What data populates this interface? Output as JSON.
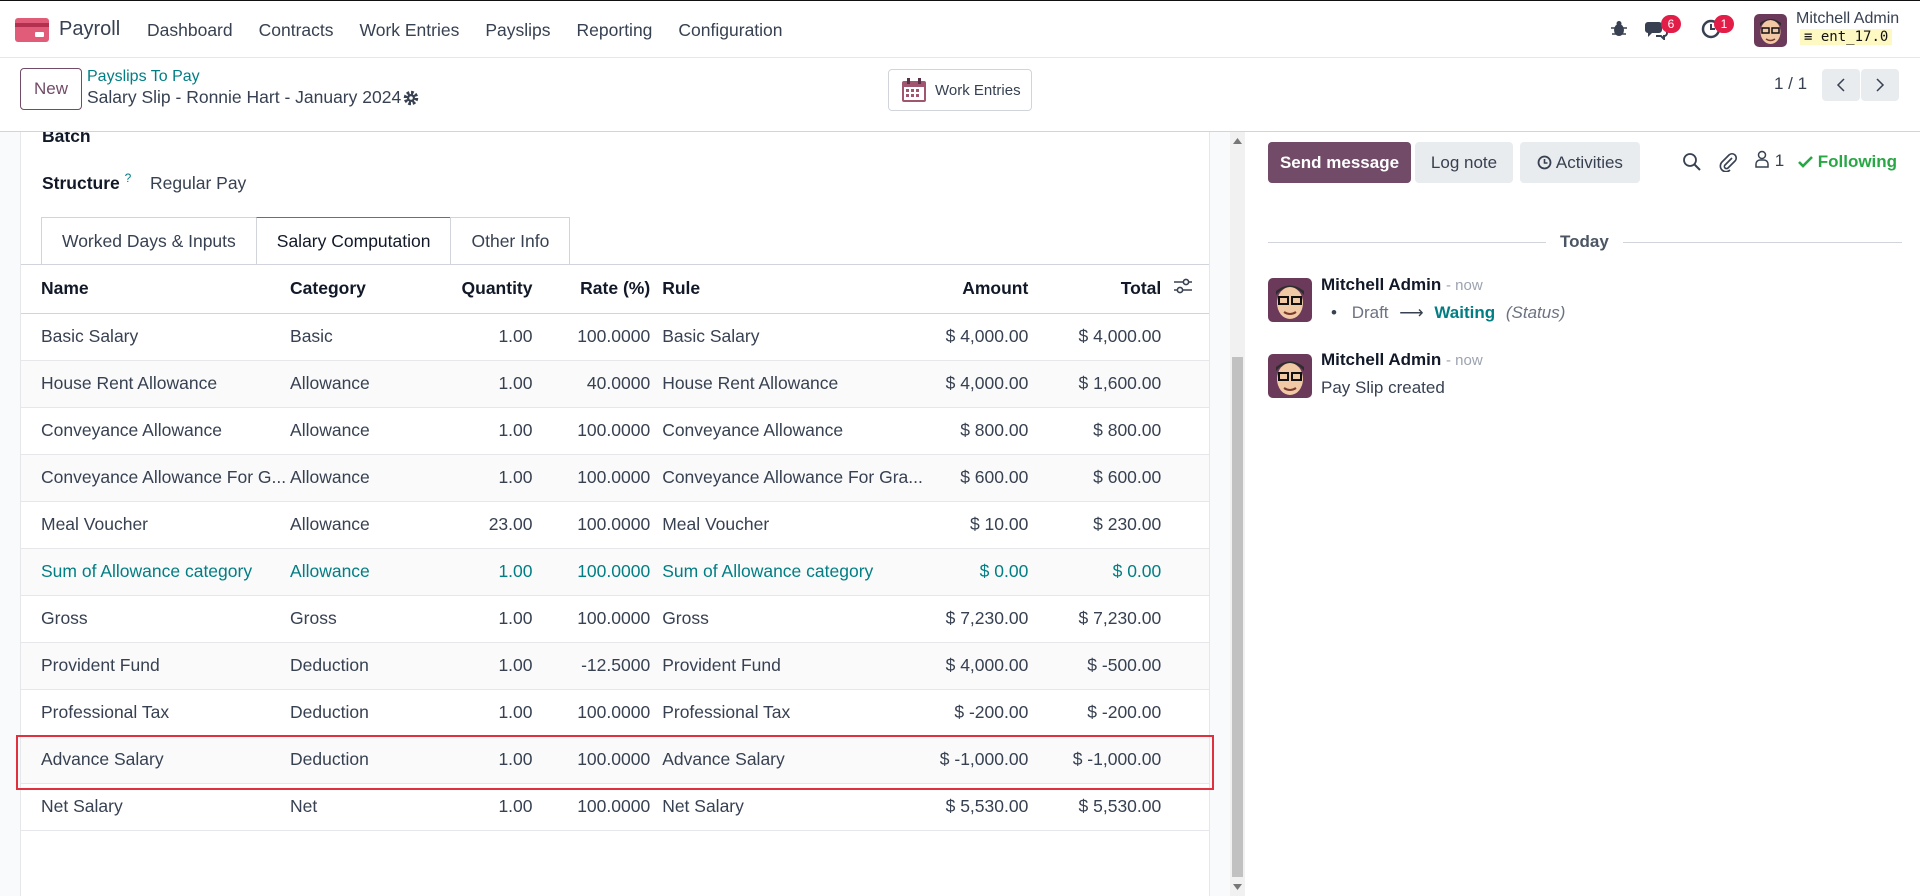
{
  "nav": {
    "app_name": "Payroll",
    "menu": [
      "Dashboard",
      "Contracts",
      "Work Entries",
      "Payslips",
      "Reporting",
      "Configuration"
    ],
    "messages_count": "6",
    "activities_count": "1",
    "user_name": "Mitchell Admin",
    "db_name": "ent_17.0"
  },
  "control": {
    "new_label": "New",
    "breadcrumb": "Payslips To Pay",
    "record_title": "Salary Slip - Ronnie Hart - January 2024",
    "work_entries_label": "Work Entries",
    "pager": "1 / 1"
  },
  "form": {
    "batch_label": "Batch",
    "structure_label": "Structure",
    "structure_help": "?",
    "structure_value": "Regular Pay",
    "tabs": [
      "Worked Days & Inputs",
      "Salary Computation",
      "Other Info"
    ],
    "columns": {
      "name": "Name",
      "category": "Category",
      "quantity": "Quantity",
      "rate": "Rate (%)",
      "rule": "Rule",
      "amount": "Amount",
      "total": "Total"
    },
    "rows": [
      {
        "name": "Basic Salary",
        "category": "Basic",
        "quantity": "1.00",
        "rate": "100.0000",
        "rule": "Basic Salary",
        "amount": "$ 4,000.00",
        "total": "$ 4,000.00"
      },
      {
        "name": "House Rent Allowance",
        "category": "Allowance",
        "quantity": "1.00",
        "rate": "40.0000",
        "rule": "House Rent Allowance",
        "amount": "$ 4,000.00",
        "total": "$ 1,600.00"
      },
      {
        "name": "Conveyance Allowance",
        "category": "Allowance",
        "quantity": "1.00",
        "rate": "100.0000",
        "rule": "Conveyance Allowance",
        "amount": "$ 800.00",
        "total": "$ 800.00"
      },
      {
        "name": "Conveyance Allowance For G...",
        "category": "Allowance",
        "quantity": "1.00",
        "rate": "100.0000",
        "rule": "Conveyance Allowance For Gra...",
        "amount": "$ 600.00",
        "total": "$ 600.00"
      },
      {
        "name": "Meal Voucher",
        "category": "Allowance",
        "quantity": "23.00",
        "rate": "100.0000",
        "rule": "Meal Voucher",
        "amount": "$ 10.00",
        "total": "$ 230.00"
      },
      {
        "name": "Sum of Allowance category",
        "category": "Allowance",
        "quantity": "1.00",
        "rate": "100.0000",
        "rule": "Sum of Allowance category",
        "amount": "$ 0.00",
        "total": "$ 0.00"
      },
      {
        "name": "Gross",
        "category": "Gross",
        "quantity": "1.00",
        "rate": "100.0000",
        "rule": "Gross",
        "amount": "$ 7,230.00",
        "total": "$ 7,230.00"
      },
      {
        "name": "Provident Fund",
        "category": "Deduction",
        "quantity": "1.00",
        "rate": "-12.5000",
        "rule": "Provident Fund",
        "amount": "$ 4,000.00",
        "total": "$ -500.00"
      },
      {
        "name": "Professional Tax",
        "category": "Deduction",
        "quantity": "1.00",
        "rate": "100.0000",
        "rule": "Professional Tax",
        "amount": "$ -200.00",
        "total": "$ -200.00"
      },
      {
        "name": "Advance Salary",
        "category": "Deduction",
        "quantity": "1.00",
        "rate": "100.0000",
        "rule": "Advance Salary",
        "amount": "$ -1,000.00",
        "total": "$ -1,000.00"
      },
      {
        "name": "Net Salary",
        "category": "Net",
        "quantity": "1.00",
        "rate": "100.0000",
        "rule": "Net Salary",
        "amount": "$ 5,530.00",
        "total": "$ 5,530.00"
      }
    ]
  },
  "chatter": {
    "send_message": "Send message",
    "log_note": "Log note",
    "activities": "Activities",
    "followers_count": "1",
    "following": "Following",
    "date_separator": "Today",
    "messages": [
      {
        "author": "Mitchell Admin",
        "time": "- now",
        "from": "Draft",
        "to": "Waiting",
        "field": "(Status)"
      },
      {
        "author": "Mitchell Admin",
        "time": "- now",
        "body": "Pay Slip created"
      }
    ]
  },
  "colors": {
    "brand": "#714b67",
    "link": "#017e84",
    "following": "#28a745",
    "badge": "#e11d48",
    "highlight": "#e0313e"
  }
}
